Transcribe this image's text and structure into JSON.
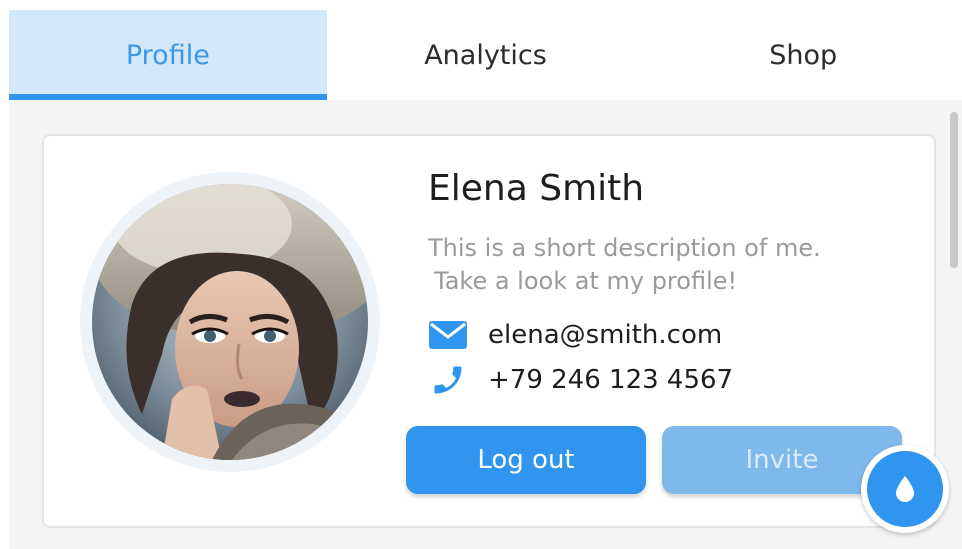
{
  "tabs": [
    {
      "label": "Profile",
      "active": true
    },
    {
      "label": "Analytics",
      "active": false
    },
    {
      "label": "Shop",
      "active": false
    }
  ],
  "profile": {
    "name": "Elena Smith",
    "description_line1": "This is a short description of me.",
    "description_line2": "Take a look at my profile!",
    "email": "elena@smith.com",
    "phone": "+79 246 123 4567"
  },
  "buttons": {
    "logout_label": "Log out",
    "invite_label": "Invite"
  },
  "icons": {
    "email": "envelope-icon",
    "phone": "phone-icon",
    "fab": "water-drop-icon"
  },
  "colors": {
    "accent": "#2f95ee",
    "active_tab_bg": "#d3e9fb",
    "disabled_button": "#7fb8ea",
    "description_text": "#9a9a9a"
  }
}
